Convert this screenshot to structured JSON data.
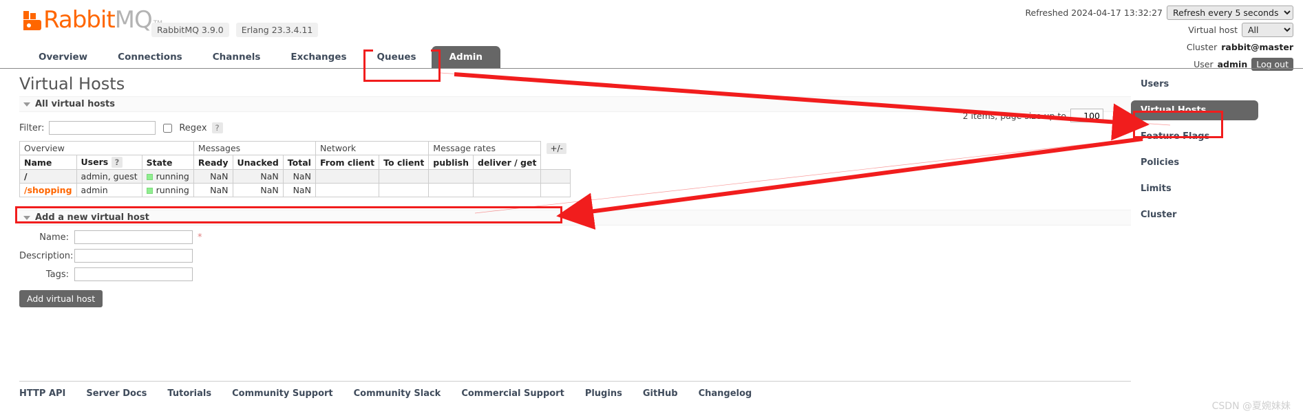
{
  "header": {
    "logo": {
      "rabbit": "Rabbit",
      "mq": "MQ",
      "tm": "TM"
    },
    "version_pills": [
      "RabbitMQ 3.9.0",
      "Erlang 23.3.4.11"
    ],
    "refreshed_label": "Refreshed 2024-04-17 13:32:27",
    "refresh_select_value": "Refresh every 5 seconds",
    "refresh_options": [
      "Refresh every 5 seconds"
    ],
    "vhost_label": "Virtual host",
    "vhost_select_value": "All",
    "vhost_options": [
      "All"
    ],
    "cluster_label": "Cluster",
    "cluster_name": "rabbit@master",
    "user_label": "User",
    "user_name": "admin",
    "logout_label": "Log out"
  },
  "tabs": [
    {
      "label": "Overview",
      "active": false
    },
    {
      "label": "Connections",
      "active": false
    },
    {
      "label": "Channels",
      "active": false
    },
    {
      "label": "Exchanges",
      "active": false
    },
    {
      "label": "Queues",
      "active": false
    },
    {
      "label": "Admin",
      "active": true
    }
  ],
  "main": {
    "page_title": "Virtual Hosts",
    "all_vhosts_section": "All virtual hosts",
    "filter_label": "Filter:",
    "filter_value": "",
    "filter_placeholder": "",
    "regex_label": "Regex",
    "regex_help": "?",
    "regex_checked": false,
    "items_text": "2 items, page size up to",
    "page_size": "100",
    "plus_minus": "+/-"
  },
  "table": {
    "group_headers": [
      {
        "label": "Overview",
        "span": 3
      },
      {
        "label": "Messages",
        "span": 3
      },
      {
        "label": "Network",
        "span": 2
      },
      {
        "label": "Message rates",
        "span": 2
      }
    ],
    "columns": [
      "Name",
      "Users",
      "State",
      "Ready",
      "Unacked",
      "Total",
      "From client",
      "To client",
      "publish",
      "deliver / get"
    ],
    "users_help": "?",
    "rows": [
      {
        "name": "/",
        "name_kind": "root",
        "users": "admin, guest",
        "state": "running",
        "ready": "NaN",
        "unacked": "NaN",
        "total": "NaN",
        "from_client": "",
        "to_client": "",
        "publish": "",
        "deliver_get": ""
      },
      {
        "name": "/shopping",
        "name_kind": "link",
        "users": "admin",
        "state": "running",
        "ready": "NaN",
        "unacked": "NaN",
        "total": "NaN",
        "from_client": "",
        "to_client": "",
        "publish": "",
        "deliver_get": ""
      }
    ]
  },
  "add_form": {
    "section_title": "Add a new virtual host",
    "name_label": "Name:",
    "name_value": "",
    "required_marker": "*",
    "description_label": "Description:",
    "description_value": "",
    "tags_label": "Tags:",
    "tags_value": "",
    "submit_label": "Add virtual host"
  },
  "sidebar": {
    "items": [
      {
        "label": "Users",
        "active": false
      },
      {
        "label": "Virtual Hosts",
        "active": true
      },
      {
        "label": "Feature Flags",
        "active": false
      },
      {
        "label": "Policies",
        "active": false
      },
      {
        "label": "Limits",
        "active": false
      },
      {
        "label": "Cluster",
        "active": false
      }
    ]
  },
  "footer": {
    "links": [
      "HTTP API",
      "Server Docs",
      "Tutorials",
      "Community Support",
      "Community Slack",
      "Commercial Support",
      "Plugins",
      "GitHub",
      "Changelog"
    ]
  },
  "watermark": "CSDN @夏婉妹妹",
  "colors": {
    "brand_orange": "#f60",
    "annotation_red": "#f11d1d",
    "active_gray": "#666666",
    "running_green": "#90ee90",
    "nav_text": "#3f4b5b"
  }
}
